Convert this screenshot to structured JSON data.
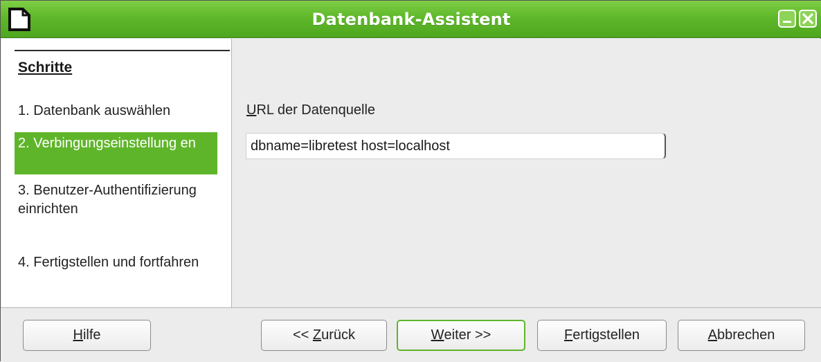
{
  "window": {
    "title": "Datenbank-Assistent"
  },
  "steps": {
    "heading": "Schritte",
    "items": [
      {
        "label": "1. Datenbank auswählen",
        "active": false
      },
      {
        "label": "2. Verbingungseinstellung en",
        "active": true
      },
      {
        "label": "3. Benutzer-Authentifizierung einrichten",
        "active": false
      },
      {
        "label": "4. Fertigstellen und fortfahren",
        "active": false
      }
    ]
  },
  "form": {
    "url_label_accel": "U",
    "url_label_rest": "RL der Datenquelle",
    "url_value": "dbname=libretest host=localhost"
  },
  "buttons": {
    "help": {
      "accel": "H",
      "rest": "ilfe"
    },
    "back": {
      "prefix": "<< ",
      "accel": "Z",
      "rest": "urück"
    },
    "next": {
      "accel": "W",
      "rest": "eiter >>"
    },
    "finish": {
      "accel": "F",
      "rest": "ertigstellen"
    },
    "cancel": {
      "accel": "A",
      "rest": "bbrechen"
    }
  },
  "colors": {
    "accent": "#5fb52a",
    "titlebar": "#5fb82a"
  },
  "icons": [
    "app-icon",
    "minimize-icon",
    "close-icon"
  ]
}
